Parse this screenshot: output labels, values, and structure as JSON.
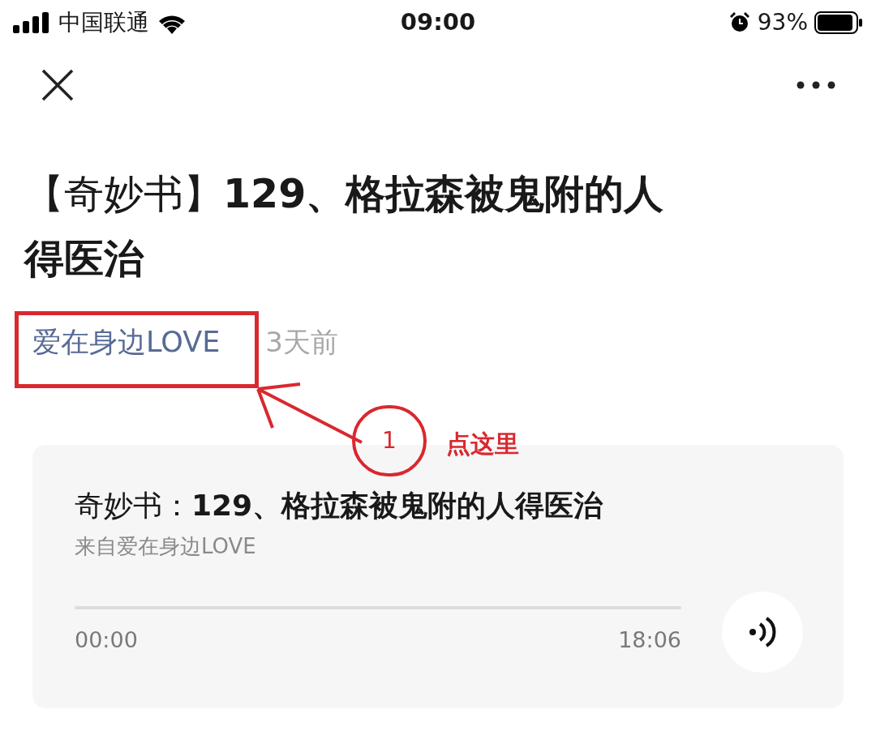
{
  "status_bar": {
    "carrier": "中国联通",
    "time": "09:00",
    "battery": "93%"
  },
  "article": {
    "title": "【奇妙书】**129、格拉森被鬼附的人得医治**",
    "author": "爱在身边LOVE",
    "time_ago": "3天前"
  },
  "annotation": {
    "step": "1",
    "note": "点这里"
  },
  "audio": {
    "title": "奇妙书：**129、格拉森被鬼附的人得医治**",
    "source": "来自爱在身边LOVE",
    "elapsed": "00:00",
    "duration": "18:06"
  }
}
